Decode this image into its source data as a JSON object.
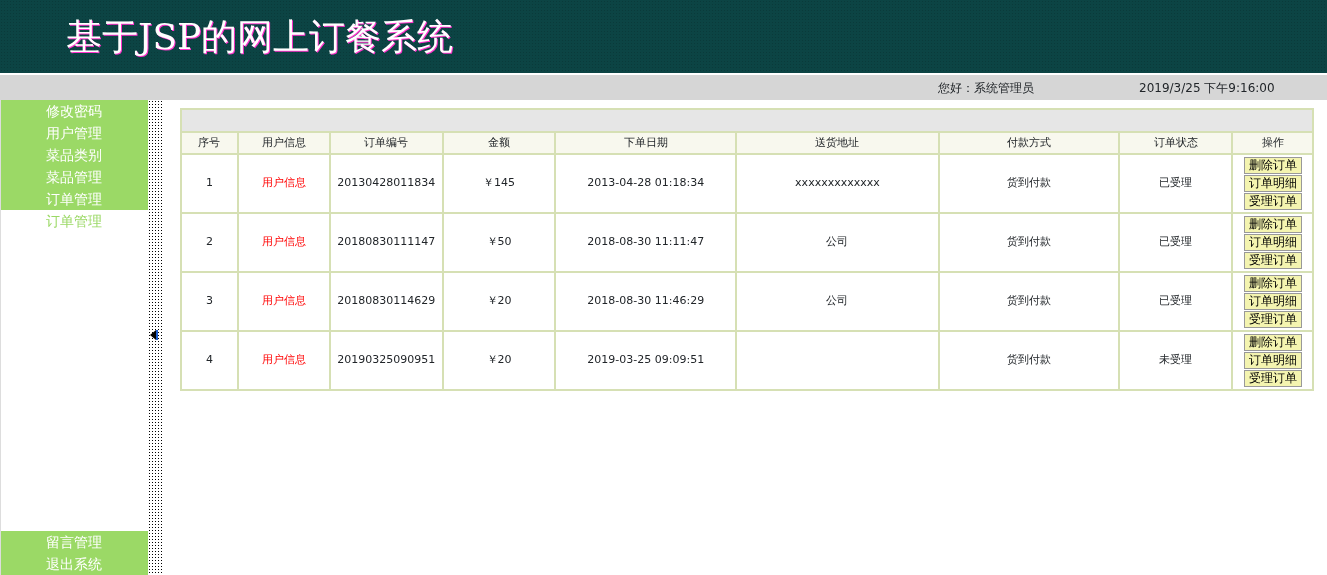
{
  "header": {
    "title": "基于JSP的网上订餐系统"
  },
  "status_bar": {
    "greeting": "您好：系统管理员",
    "datetime": "2019/3/25 下午9:16:00"
  },
  "sidebar": {
    "items": [
      {
        "label": "修改密码",
        "kind": "menu"
      },
      {
        "label": "用户管理",
        "kind": "menu"
      },
      {
        "label": "菜品类别",
        "kind": "menu"
      },
      {
        "label": "菜品管理",
        "kind": "menu"
      },
      {
        "label": "订单管理",
        "kind": "menu"
      },
      {
        "label": "订单管理",
        "kind": "submenu"
      }
    ],
    "bottom_items": [
      {
        "label": "留言管理"
      },
      {
        "label": "退出系统"
      }
    ]
  },
  "table": {
    "columns": [
      "序号",
      "用户信息",
      "订单编号",
      "金额",
      "下单日期",
      "送货地址",
      "付款方式",
      "订单状态",
      "操作"
    ],
    "rows": [
      {
        "no": "1",
        "user": "用户信息",
        "order_no": "20130428011834",
        "amount": "￥145",
        "date": "2013-04-28 01:18:34",
        "address": "xxxxxxxxxxxxx",
        "payment": "货到付款",
        "status": "已受理",
        "actions": [
          "删除订单",
          "订单明细",
          "受理订单"
        ]
      },
      {
        "no": "2",
        "user": "用户信息",
        "order_no": "20180830111147",
        "amount": "￥50",
        "date": "2018-08-30 11:11:47",
        "address": "公司",
        "payment": "货到付款",
        "status": "已受理",
        "actions": [
          "删除订单",
          "订单明细",
          "受理订单"
        ]
      },
      {
        "no": "3",
        "user": "用户信息",
        "order_no": "20180830114629",
        "amount": "￥20",
        "date": "2018-08-30 11:46:29",
        "address": "公司",
        "payment": "货到付款",
        "status": "已受理",
        "actions": [
          "删除订单",
          "订单明细",
          "受理订单"
        ]
      },
      {
        "no": "4",
        "user": "用户信息",
        "order_no": "20190325090951",
        "amount": "￥20",
        "date": "2019-03-25 09:09:51",
        "payment": "货到付款",
        "status": "未受理",
        "actions": [
          "删除订单",
          "订单明细",
          "受理订单"
        ]
      }
    ]
  }
}
